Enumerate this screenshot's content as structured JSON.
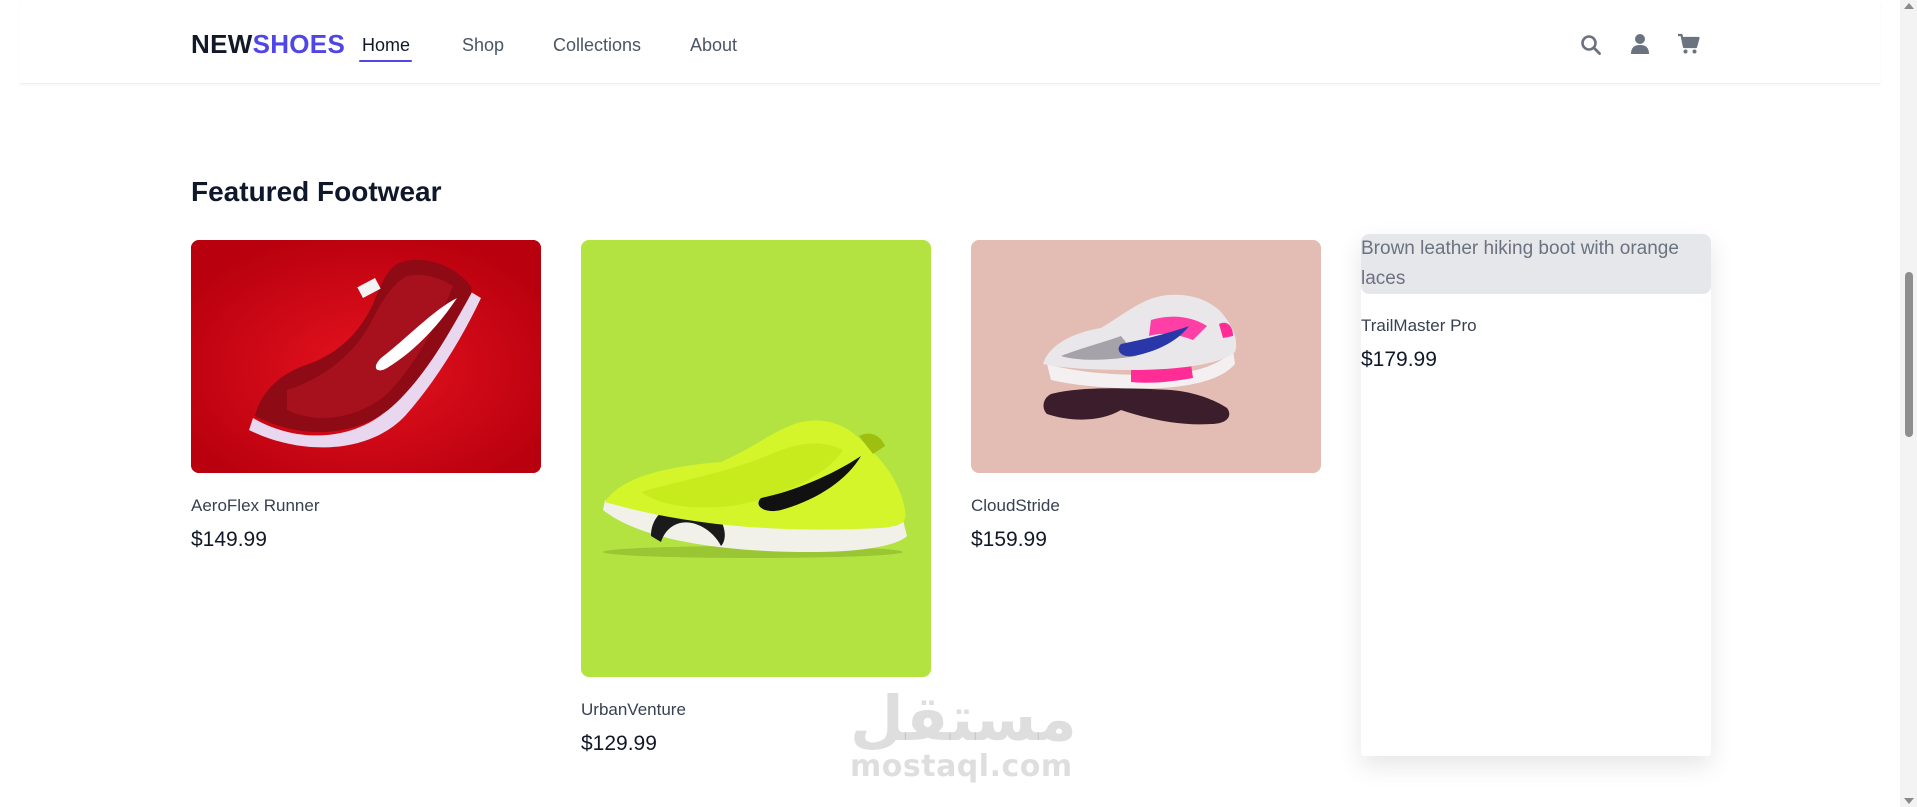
{
  "header": {
    "logo_part1": "NEW",
    "logo_part2": "SHOES",
    "nav": [
      "Home",
      "Shop",
      "Collections",
      "About"
    ],
    "active_nav": "Home"
  },
  "icons": [
    "search-icon",
    "user-icon",
    "cart-icon"
  ],
  "section": {
    "title": "Featured Footwear"
  },
  "products": [
    {
      "name": "AeroFlex Runner",
      "price": "$149.99",
      "image_bg": "#d0021b",
      "image": "red running shoe"
    },
    {
      "name": "UrbanVenture",
      "price": "$129.99",
      "image_bg": "#b3e340",
      "image": "neon green trainer"
    },
    {
      "name": "CloudStride",
      "price": "$159.99",
      "image_bg": "#e3bcb3",
      "image": "white pink sneaker"
    },
    {
      "name": "TrailMaster Pro",
      "price": "$179.99",
      "image_alt": "Brown leather hiking boot with orange laces"
    }
  ],
  "watermark": {
    "arabic": "مستقل",
    "latin": "mostaql.com"
  },
  "colors": {
    "accent": "#4f46e5",
    "text": "#111827",
    "muted": "#4b5563"
  }
}
